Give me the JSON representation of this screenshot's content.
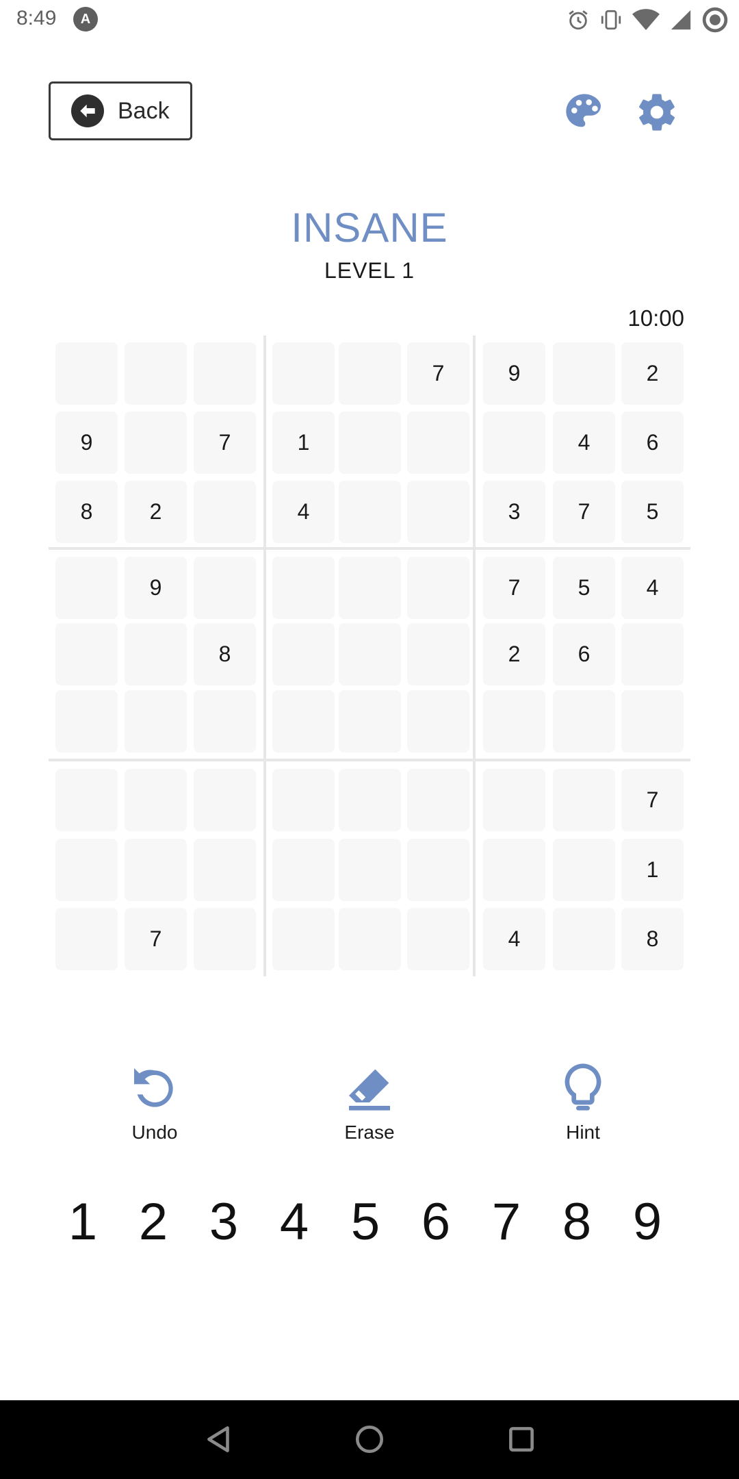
{
  "status_bar": {
    "time": "8:49",
    "app_icon": "A",
    "icons": [
      "alarm-icon",
      "vibrate-icon",
      "wifi-icon",
      "signal-icon",
      "record-icon"
    ]
  },
  "header": {
    "back_label": "Back",
    "palette_icon": "palette-icon",
    "settings_icon": "gear-icon"
  },
  "game": {
    "difficulty": "INSANE",
    "level": "LEVEL 1",
    "timer": "10:00",
    "board": [
      [
        "",
        "",
        "",
        "",
        "",
        "7",
        "9",
        "",
        "2"
      ],
      [
        "9",
        "",
        "7",
        "1",
        "",
        "",
        "",
        "4",
        "6"
      ],
      [
        "8",
        "2",
        "",
        "4",
        "",
        "",
        "3",
        "7",
        "5"
      ],
      [
        "",
        "9",
        "",
        "",
        "",
        "",
        "7",
        "5",
        "4"
      ],
      [
        "",
        "",
        "8",
        "",
        "",
        "",
        "2",
        "6",
        ""
      ],
      [
        "",
        "",
        "",
        "",
        "",
        "",
        "",
        "",
        ""
      ],
      [
        "",
        "",
        "",
        "",
        "",
        "",
        "",
        "",
        "7"
      ],
      [
        "",
        "",
        "",
        "",
        "",
        "",
        "",
        "",
        "1"
      ],
      [
        "",
        "7",
        "",
        "",
        "",
        "",
        "4",
        "",
        "8"
      ]
    ]
  },
  "tools": [
    {
      "label": "Undo",
      "icon": "undo-icon"
    },
    {
      "label": "Erase",
      "icon": "eraser-icon"
    },
    {
      "label": "Hint",
      "icon": "lightbulb-icon"
    }
  ],
  "numpad": [
    "1",
    "2",
    "3",
    "4",
    "5",
    "6",
    "7",
    "8",
    "9"
  ],
  "nav": [
    "back-triangle-icon",
    "home-circle-icon",
    "recents-square-icon"
  ],
  "colors": {
    "accent": "#6f8ec4",
    "cell_bg": "#f7f7f7",
    "separator": "#e7e7e7"
  }
}
